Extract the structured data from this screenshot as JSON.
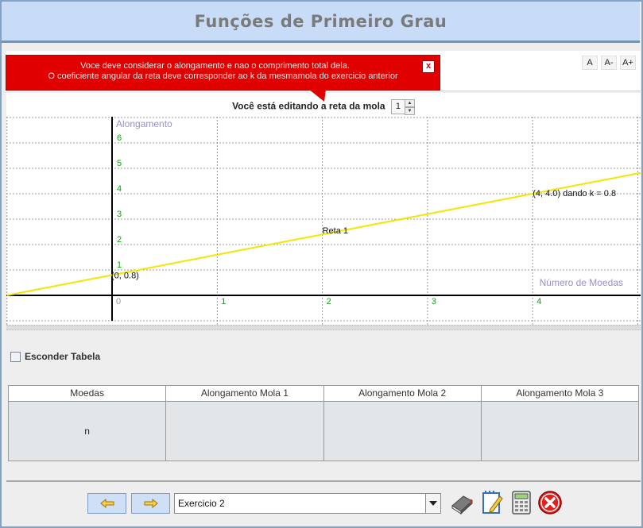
{
  "app": {
    "title": "Funções de Primeiro Grau"
  },
  "font_controls": {
    "small": "A",
    "decrease": "A-",
    "increase": "A+"
  },
  "tooltip": {
    "line1": "Voce deve considerar o alongamento e nao o comprimento total dela.",
    "line2": "O coeficiente angular da reta deve corresponder ao k da mesmamola do exercicio anterior",
    "close": "x"
  },
  "graph": {
    "caption": "Você está editando a reta da mola",
    "spring_number": "1",
    "y_axis_label": "Alongamento",
    "x_axis_label": "Número de Moedas",
    "x_ticks": [
      "0",
      "1",
      "2",
      "3",
      "4"
    ],
    "y_ticks": [
      "1",
      "2",
      "3",
      "4",
      "5",
      "6"
    ],
    "line_label": "Reta 1",
    "point_start_label": "(0, 0.8)",
    "point_end_label": "(4, 4.0) dando k = 0.8",
    "line_color": "#f2e600",
    "axis_number_color": "#13a313",
    "axis_label_color": "#9a8fc9",
    "line": {
      "x0": 0,
      "y0": 0.8,
      "slope": 0.8
    }
  },
  "options": {
    "hide_table_label": "Esconder Tabela",
    "hide_table_checked": false
  },
  "table": {
    "headers": [
      "Moedas",
      "Alongamento Mola 1",
      "Alongamento Mola 2",
      "Alongamento Mola 3"
    ],
    "row": [
      "n",
      "",
      "",
      ""
    ]
  },
  "bottom": {
    "prev_icon": "arrow-left-icon",
    "next_icon": "arrow-right-icon",
    "exercise_select": "Exercicio 2",
    "tools": [
      "book-icon",
      "notepad-icon",
      "calculator-icon",
      "close-icon"
    ]
  }
}
